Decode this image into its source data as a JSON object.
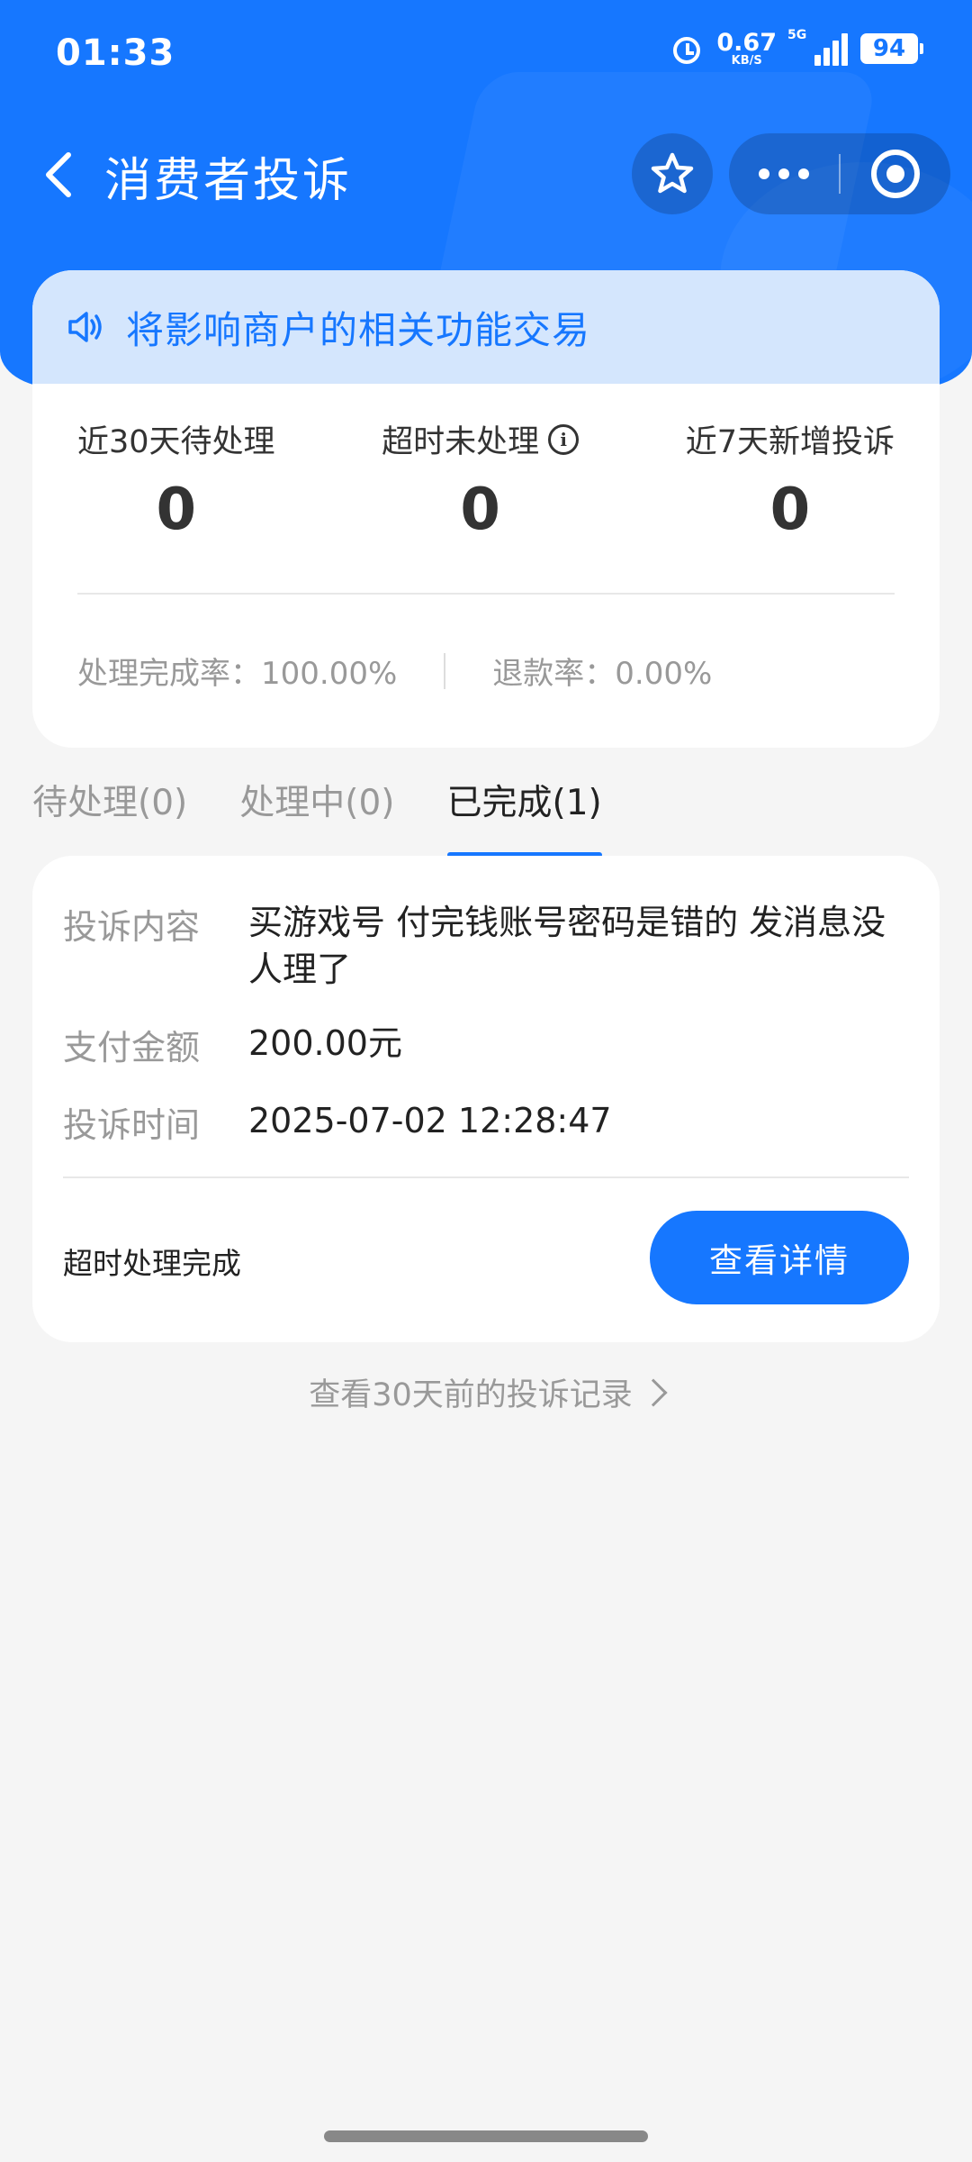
{
  "status_bar": {
    "time": "01:33",
    "net_speed": "0.67",
    "net_unit": "KB/S",
    "network": "5G",
    "battery": "94"
  },
  "nav": {
    "title": "消费者投诉",
    "icons": [
      "back-icon",
      "star-icon",
      "more-icon",
      "target-icon"
    ]
  },
  "notice": {
    "text": "将影响商户的相关功能交易"
  },
  "stats": [
    {
      "label": "近30天待处理",
      "value": "0"
    },
    {
      "label": "超时未处理",
      "value": "0"
    },
    {
      "label": "近7天新增投诉",
      "value": "0"
    }
  ],
  "rates": {
    "completion": "处理完成率：100.00%",
    "refund": "退款率：0.00%"
  },
  "tabs": [
    {
      "label": "待处理(0)",
      "active": false
    },
    {
      "label": "处理中(0)",
      "active": false
    },
    {
      "label": "已完成(1)",
      "active": true
    }
  ],
  "complaint": {
    "content_label": "投诉内容",
    "content_value": "买游戏号 付完钱账号密码是错的 发消息没人理了",
    "amount_label": "支付金额",
    "amount_value": "200.00元",
    "time_label": "投诉时间",
    "time_value": "2025-07-02 12:28:47",
    "status": "超时处理完成",
    "button": "查看详情"
  },
  "history_link": "查看30天前的投诉记录",
  "colors": {
    "primary": "#1677ff",
    "notice_bg": "#d4e6fd",
    "page_bg": "#f5f5f5"
  }
}
